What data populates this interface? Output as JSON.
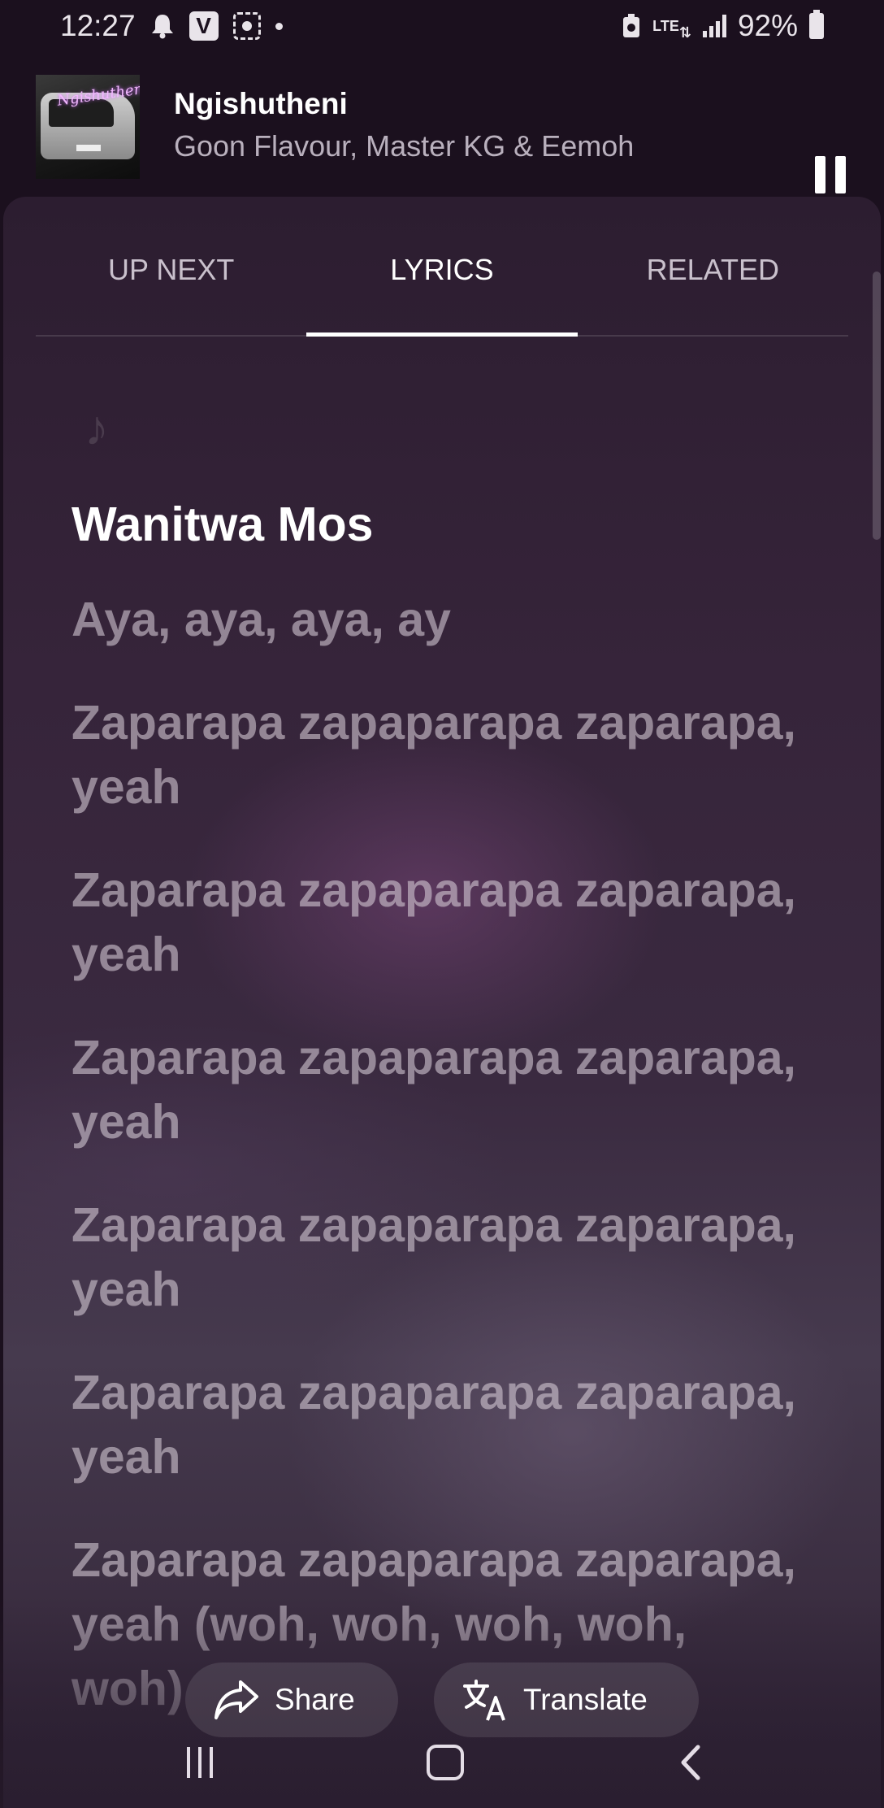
{
  "status_bar": {
    "time": "12:27",
    "app_badge": "V",
    "network": "LTE",
    "battery": "92%"
  },
  "player": {
    "title": "Ngishutheni",
    "artist": "Goon Flavour, Master KG & Eemoh",
    "album_art_script": "Ngishutheni"
  },
  "tabs": [
    {
      "label": "UP NEXT",
      "active": false
    },
    {
      "label": "LYRICS",
      "active": true
    },
    {
      "label": "RELATED",
      "active": false
    }
  ],
  "lyrics": {
    "lines": [
      "Wanitwa Mos",
      "Aya, aya, aya, ay",
      "Zaparapa zapaparapa zaparapa, yeah",
      "Zaparapa zapaparapa zaparapa, yeah",
      "Zaparapa zapaparapa zaparapa, yeah",
      "Zaparapa zapaparapa zaparapa, yeah",
      "Zaparapa zapaparapa zaparapa, yeah",
      "Zaparapa zapaparapa zaparapa, yeah (woh, woh, woh, woh, woh)"
    ],
    "current_index": 0
  },
  "actions": {
    "share_label": "Share",
    "translate_label": "Translate"
  },
  "icons": {
    "share": "share-arrow-icon",
    "translate": "translate-icon",
    "music_note": "music-note-icon"
  }
}
